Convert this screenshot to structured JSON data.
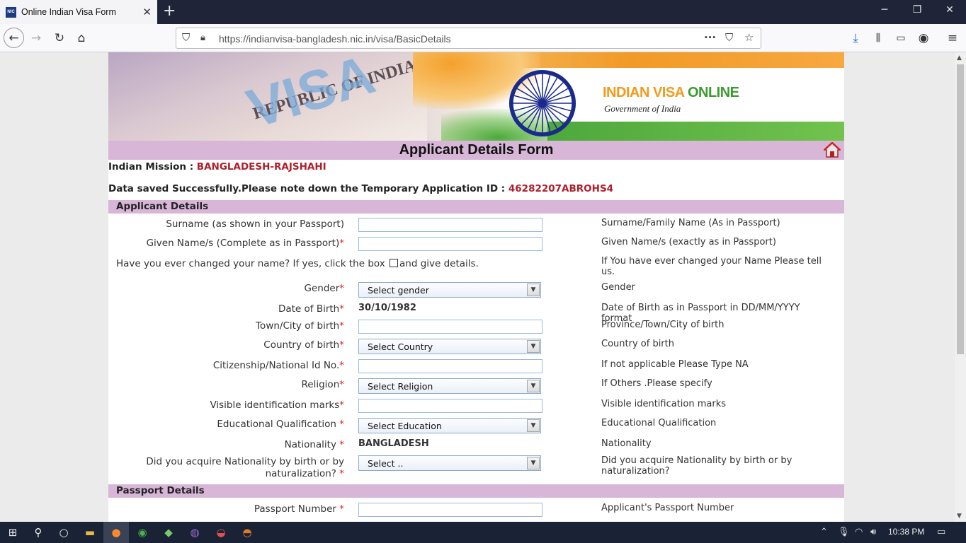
{
  "browser": {
    "tab_title": "Online Indian Visa Form",
    "favicon_text": "NIC",
    "url_host": "https://indianvisa-bangladesh.nic.in",
    "url_path": "/visa/BasicDetails"
  },
  "banner": {
    "visa_text": "VISA",
    "republic_text": "REPUBLIC OF INDIA",
    "brand_part1": "INDIAN VISA ",
    "brand_part2": "ONLINE",
    "brand_sub": "Government of India"
  },
  "form": {
    "title": "Applicant Details Form",
    "mission_label": "Indian Mission : ",
    "mission_value": "BANGLADESH-RAJSHAHI",
    "saved_msg": "Data saved Successfully.Please note down the Temporary Application ID : ",
    "app_id": "46282207ABROHS4",
    "section_applicant": "Applicant Details",
    "section_passport": "Passport Details",
    "fields": {
      "surname": {
        "label": "Surname (as shown in your Passport)",
        "hint": "Surname/Family Name (As in Passport)"
      },
      "given_name": {
        "label": "Given Name/s (Complete as in Passport)",
        "hint": "Given Name/s (exactly as in Passport)"
      },
      "changed_name": {
        "label_before": "Have you ever changed your name? If yes, click the box ",
        "label_after": "and give details.",
        "hint": "If You have ever changed your Name Please tell us."
      },
      "gender": {
        "label": "Gender",
        "selected": "Select gender",
        "hint": "Gender"
      },
      "dob": {
        "label": "Date of Birth",
        "value": "30/10/1982",
        "hint": "Date of Birth as in Passport in DD/MM/YYYY format"
      },
      "town": {
        "label": "Town/City of birth",
        "hint": "Province/Town/City of birth"
      },
      "country": {
        "label": "Country of birth",
        "selected": "Select Country",
        "hint": "Country of birth"
      },
      "citizenship": {
        "label": "Citizenship/National Id No.",
        "hint": "If not applicable Please Type NA"
      },
      "religion": {
        "label": "Religion",
        "selected": "Select Religion",
        "hint": "If Others .Please specify"
      },
      "marks": {
        "label": "Visible identification marks",
        "hint": "Visible identification marks"
      },
      "education": {
        "label": "Educational Qualification ",
        "selected": "Select Education",
        "hint": "Educational Qualification"
      },
      "nationality": {
        "label": "Nationality ",
        "value": "BANGLADESH",
        "hint": "Nationality"
      },
      "acquire": {
        "label_line1": "Did you acquire Nationality by birth or by",
        "label_line2": "naturalization? ",
        "selected": "Select ..",
        "hint": "Did you acquire Nationality by birth or by naturalization?"
      },
      "passport_no": {
        "label": "Passport Number ",
        "hint": "Applicant's Passport Number"
      }
    },
    "required_mark": "*"
  },
  "taskbar": {
    "clock": "10:38 PM"
  }
}
